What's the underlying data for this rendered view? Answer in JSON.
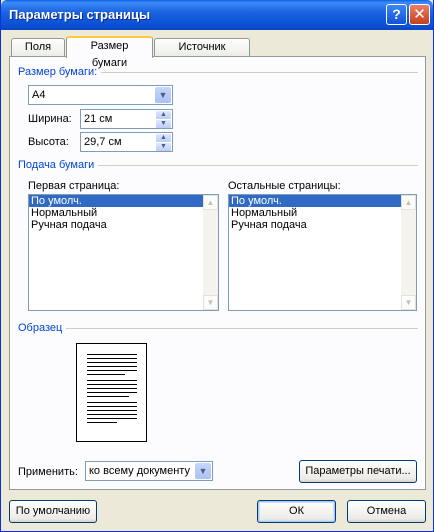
{
  "window": {
    "title": "Параметры страницы"
  },
  "titlebar_buttons": {
    "help": "?",
    "close": "✕"
  },
  "tabs": [
    {
      "label": "Поля"
    },
    {
      "label": "Размер бумаги"
    },
    {
      "label": "Источник бумаги"
    }
  ],
  "paper_size": {
    "group_title": "Размер бумаги:",
    "format": "A4",
    "width_label": "Ширина:",
    "width_value": "21 см",
    "height_label": "Высота:",
    "height_value": "29,7 см"
  },
  "paper_feed": {
    "group_title": "Подача бумаги",
    "first_page_label": "Первая страница:",
    "first_page_items": [
      "По умолч.",
      "Нормальный",
      "Ручная подача"
    ],
    "other_pages_label": "Остальные страницы:",
    "other_pages_items": [
      "По умолч.",
      "Нормальный",
      "Ручная подача"
    ]
  },
  "sample": {
    "group_title": "Образец",
    "apply_label": "Применить:",
    "apply_value": "ко всему документу",
    "print_options_button": "Параметры печати..."
  },
  "footer": {
    "default_button": "По умолчанию",
    "ok_button": "ОК",
    "cancel_button": "Отмена"
  }
}
